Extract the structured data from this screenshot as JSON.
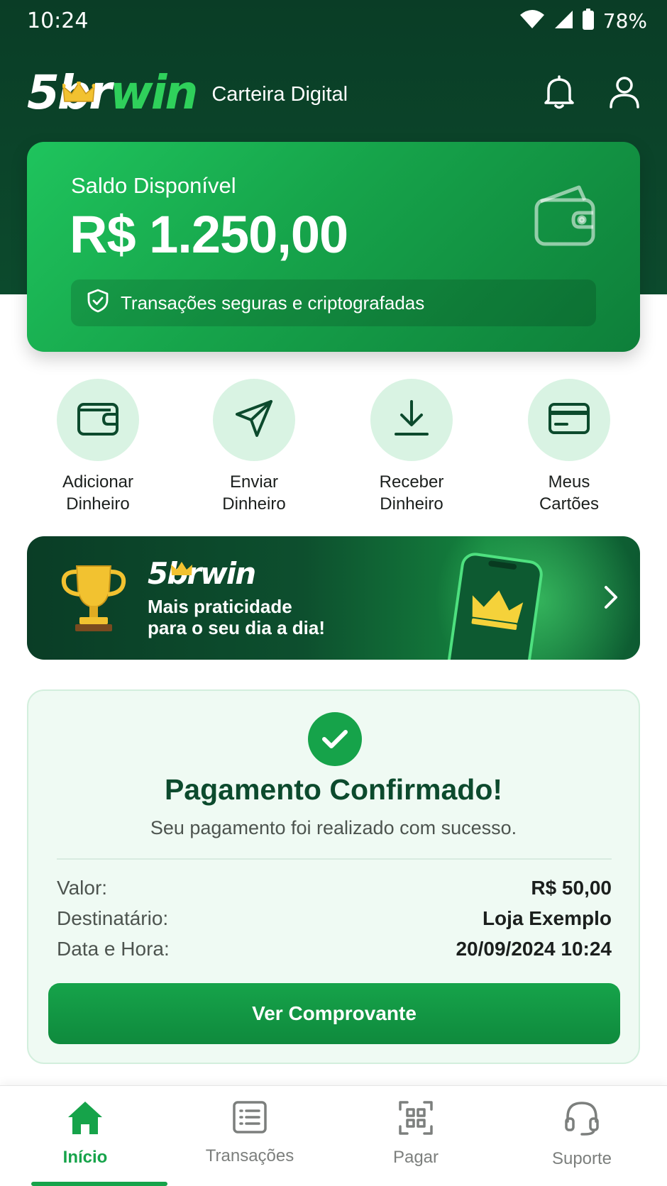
{
  "status_bar": {
    "time": "10:24",
    "battery": "78%"
  },
  "header": {
    "logo_prefix": "5br",
    "logo_suffix": "win",
    "subtitle": "Carteira Digital"
  },
  "balance": {
    "label": "Saldo Disponível",
    "value": "R$ 1.250,00",
    "security_note": "Transações seguras e criptografadas"
  },
  "quick_actions": [
    {
      "line1": "Adicionar",
      "line2": "Dinheiro",
      "icon": "wallet-icon"
    },
    {
      "line1": "Enviar",
      "line2": "Dinheiro",
      "icon": "send-icon"
    },
    {
      "line1": "Receber",
      "line2": "Dinheiro",
      "icon": "download-icon"
    },
    {
      "line1": "Meus",
      "line2": "Cartões",
      "icon": "card-icon"
    }
  ],
  "promo": {
    "logo": "5brwin",
    "line1": "Mais praticidade",
    "line2": "para o seu dia a dia!"
  },
  "confirmation": {
    "title": "Pagamento Confirmado!",
    "subtitle": "Seu pagamento foi realizado com sucesso.",
    "rows": [
      {
        "label": "Valor:",
        "value": "R$ 50,00"
      },
      {
        "label": "Destinatário:",
        "value": "Loja Exemplo"
      },
      {
        "label": "Data e Hora:",
        "value": "20/09/2024 10:24"
      }
    ],
    "button": "Ver Comprovante"
  },
  "bottom_nav": [
    {
      "label": "Início",
      "icon": "home-icon",
      "active": true
    },
    {
      "label": "Transações",
      "icon": "list-icon",
      "active": false
    },
    {
      "label": "Pagar",
      "icon": "qr-scan-icon",
      "active": false
    },
    {
      "label": "Suporte",
      "icon": "headset-icon",
      "active": false
    }
  ],
  "colors": {
    "dark_green": "#0a3d26",
    "accent": "#16a34a",
    "light_green": "#d9f3e3",
    "logo_green": "#2fd05b",
    "gold": "#f2c230"
  }
}
